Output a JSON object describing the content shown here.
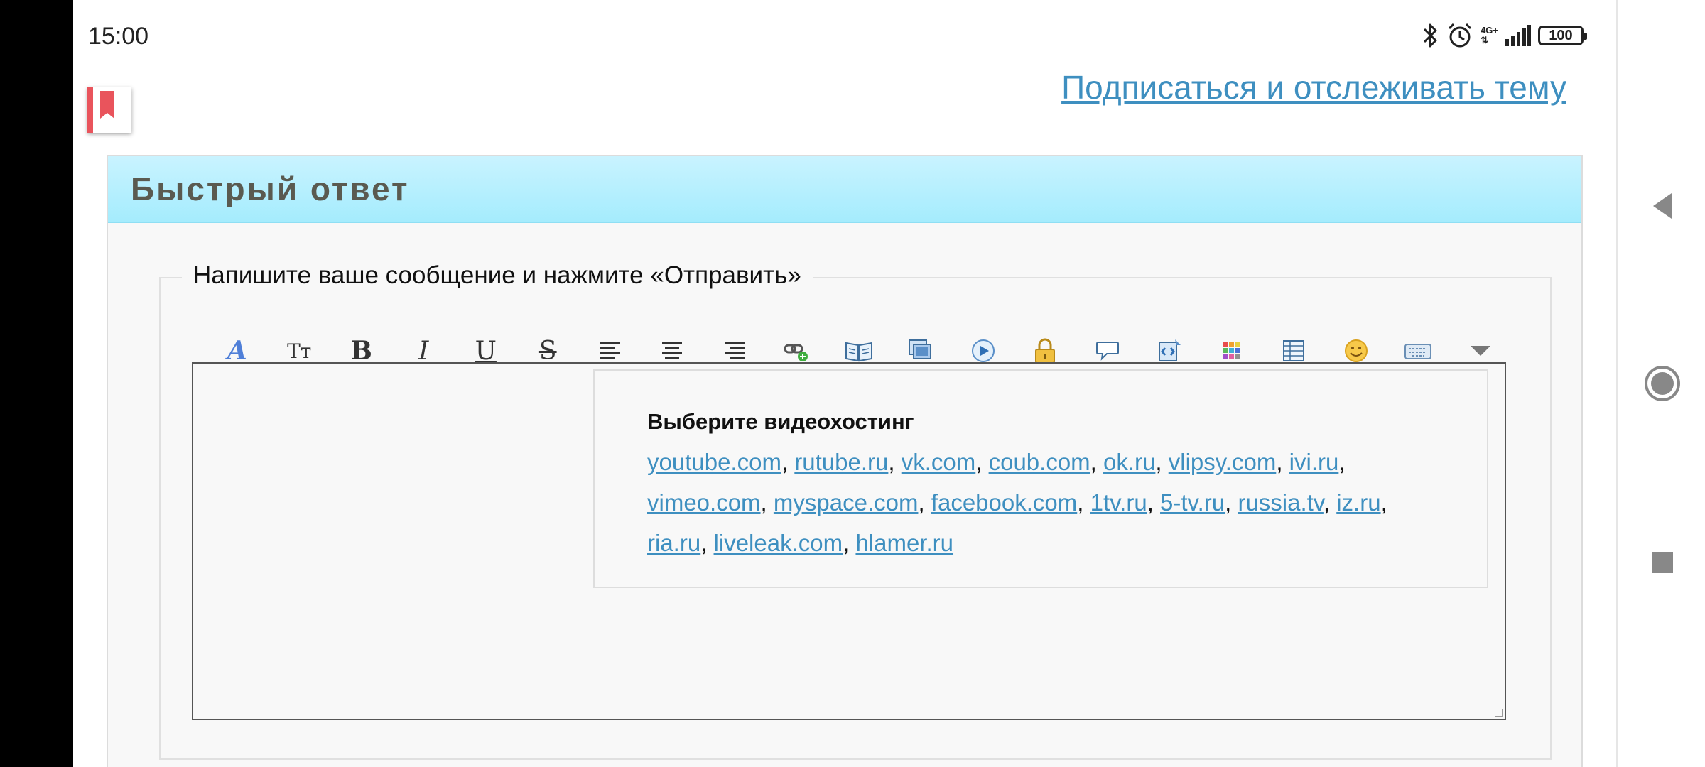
{
  "status_bar": {
    "time": "15:00",
    "network": "4G+",
    "battery": "100"
  },
  "subscribe_link": "Подписаться и отслеживать тему",
  "quick_reply": {
    "title": "Быстрый ответ",
    "legend": "Напишите ваше сообщение и нажмите «Отправить»"
  },
  "toolbar": {
    "font_label": "A",
    "size_label": "Tт",
    "bold_label": "B",
    "italic_label": "I",
    "underline_label": "U",
    "strike_label": "S"
  },
  "video_popup": {
    "title": "Выберите видеохостинг",
    "links": [
      "youtube.com",
      "rutube.ru",
      "vk.com",
      "coub.com",
      "ok.ru",
      "vlipsy.com",
      "ivi.ru",
      "vimeo.com",
      "myspace.com",
      "facebook.com",
      "1tv.ru",
      "5-tv.ru",
      "russia.tv",
      "iz.ru",
      "ria.ru",
      "liveleak.com",
      "hlamer.ru"
    ]
  },
  "colors": {
    "link": "#3e8fc0",
    "header_bg": "#a5ecfd",
    "bookmark": "#e9545c"
  },
  "icons": [
    "font-icon",
    "font-size-icon",
    "bold-icon",
    "italic-icon",
    "underline-icon",
    "strikethrough-icon",
    "align-left-icon",
    "align-center-icon",
    "align-right-icon",
    "link-icon",
    "book-icon",
    "image-icon",
    "video-icon",
    "lock-icon",
    "quote-icon",
    "code-icon",
    "color-grid-icon",
    "table-icon",
    "smiley-icon",
    "keyboard-icon",
    "more-icon"
  ]
}
